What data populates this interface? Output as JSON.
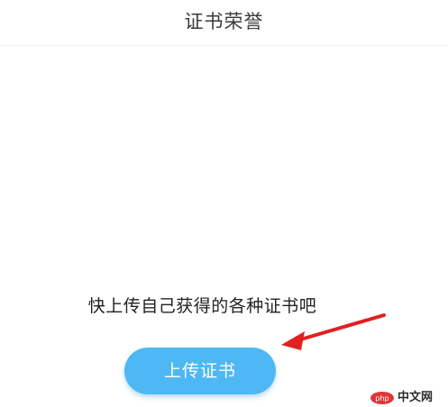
{
  "header": {
    "title": "证书荣誉"
  },
  "main": {
    "empty_hint": "快上传自己获得的各种证书吧",
    "upload_button_label": "上传证书"
  },
  "annotation": {
    "arrow_color": "#e02020"
  },
  "watermark": {
    "logo_text": "php",
    "site_text": "中文网"
  },
  "colors": {
    "accent": "#4db8f3"
  }
}
